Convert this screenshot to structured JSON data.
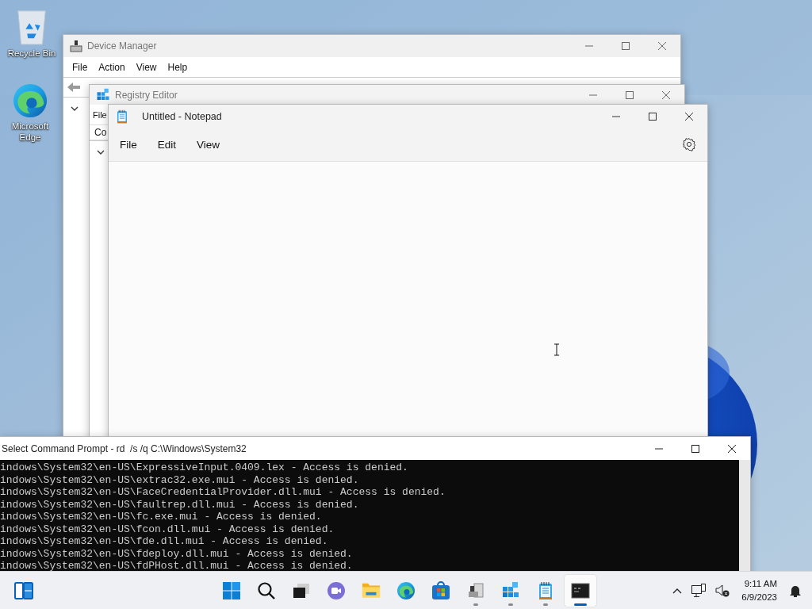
{
  "desktop_icons": [
    {
      "kind": "recycle",
      "label": "Recycle Bin"
    },
    {
      "kind": "browser",
      "label": "Microsoft Edge"
    }
  ],
  "device_manager": {
    "title": "Device Manager",
    "menu": [
      "File",
      "Action",
      "View",
      "Help"
    ]
  },
  "registry_editor": {
    "title": "Registry Editor",
    "menu": [
      "File"
    ],
    "address": "Co"
  },
  "notepad": {
    "title": "Untitled - Notepad",
    "menu": [
      "File",
      "Edit",
      "View"
    ]
  },
  "command_prompt": {
    "title": "Select Command Prompt - rd  /s /q C:\\Windows\\System32",
    "lines": [
      "indows\\System32\\en-US\\ExpressiveInput.0409.lex - Access is denied.",
      "indows\\System32\\en-US\\extrac32.exe.mui - Access is denied.",
      "indows\\System32\\en-US\\FaceCredentialProvider.dll.mui - Access is denied.",
      "indows\\System32\\en-US\\faultrep.dll.mui - Access is denied.",
      "indows\\System32\\en-US\\fc.exe.mui - Access is denied.",
      "indows\\System32\\en-US\\fcon.dll.mui - Access is denied.",
      "indows\\System32\\en-US\\fde.dll.mui - Access is denied.",
      "indows\\System32\\en-US\\fdeploy.dll.mui - Access is denied.",
      "indows\\System32\\en-US\\fdPHost.dll.mui - Access is denied."
    ]
  },
  "taskbar": {
    "apps": [
      {
        "kind": "start",
        "running": false,
        "selected": false
      },
      {
        "kind": "search",
        "running": false,
        "selected": false
      },
      {
        "kind": "taskview",
        "running": false,
        "selected": false
      },
      {
        "kind": "chat",
        "running": false,
        "selected": false
      },
      {
        "kind": "folder",
        "running": false,
        "selected": false
      },
      {
        "kind": "browser",
        "running": false,
        "selected": false
      },
      {
        "kind": "store",
        "running": false,
        "selected": false
      },
      {
        "kind": "device",
        "running": true,
        "selected": false
      },
      {
        "kind": "registry",
        "running": true,
        "selected": false
      },
      {
        "kind": "notepad",
        "running": true,
        "selected": false
      },
      {
        "kind": "terminal",
        "running": true,
        "selected": true
      }
    ],
    "clock": {
      "time": "9:11 AM",
      "date": "6/9/2023"
    }
  }
}
